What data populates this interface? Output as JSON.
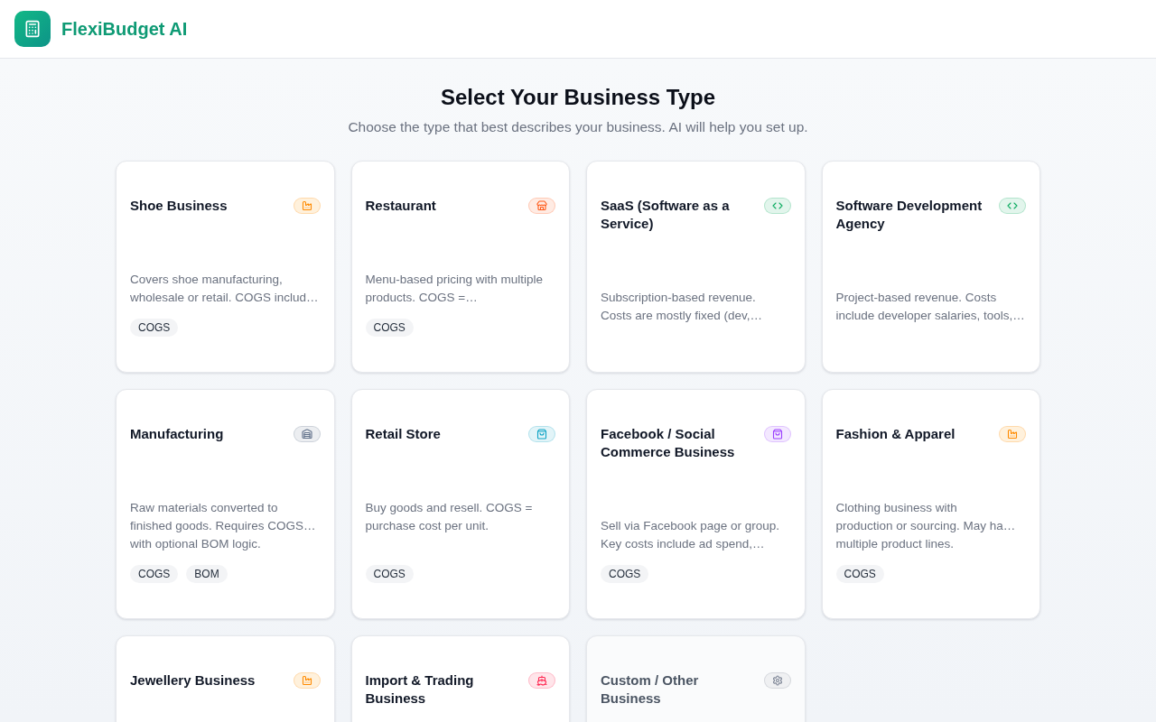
{
  "header": {
    "app_name": "FlexiBudget AI"
  },
  "page": {
    "title": "Select Your Business Type",
    "subtitle": "Choose the type that best describes your business. AI will help you set up."
  },
  "cards": [
    {
      "title": "Shoe Business",
      "kind": "production",
      "color": "#fff1dc",
      "description": "Covers shoe manufacturing,\nwholesale or retail. COGS includ…",
      "tags": [
        "COGS"
      ]
    },
    {
      "title": "Restaurant",
      "kind": "restaurant",
      "color": "#ffebe3",
      "description": "Menu-based pricing with multiple\nproducts. COGS =…",
      "tags": [
        "COGS"
      ]
    },
    {
      "title": "SaaS (Software as a Service)",
      "kind": "software",
      "color": "#e2f5ec",
      "description": "Subscription-based revenue.\nCosts are mostly fixed (dev,…"
    },
    {
      "title": "Software Development Agency",
      "kind": "software",
      "color": "#e2f5ec",
      "description": "Project-based revenue. Costs\ninclude developer salaries, tools,…"
    },
    {
      "title": "Manufacturing",
      "kind": "manufacturing",
      "color": "#eceef1",
      "description": "Raw materials converted to\nfinished goods. Requires COGS…\nwith optional BOM logic.",
      "tags": [
        "COGS",
        "BOM"
      ]
    },
    {
      "title": "Retail Store",
      "kind": "retail",
      "color": "#e2f4f8",
      "description": "Buy goods and resell. COGS =\npurchase cost per unit.",
      "tags": [
        "COGS"
      ]
    },
    {
      "title": "Facebook / Social Commerce Business",
      "kind": "social",
      "color": "#f3e8ff",
      "description": "Sell via Facebook page or group.\nKey costs include ad spend,…",
      "tags": [
        "COGS"
      ]
    },
    {
      "title": "Fashion & Apparel",
      "kind": "production",
      "color": "#fff1dc",
      "description": "Clothing business with\nproduction or sourcing. May ha…\nmultiple product lines.",
      "tags": [
        "COGS"
      ]
    },
    {
      "title": "Jewellery Business",
      "kind": "production",
      "color": "#fff1dc"
    },
    {
      "title": "Import & Trading Business",
      "kind": "trading",
      "color": "#ffe5ea"
    },
    {
      "title": "Custom / Other Business",
      "kind": "custom",
      "color": "#eff0f2"
    }
  ]
}
